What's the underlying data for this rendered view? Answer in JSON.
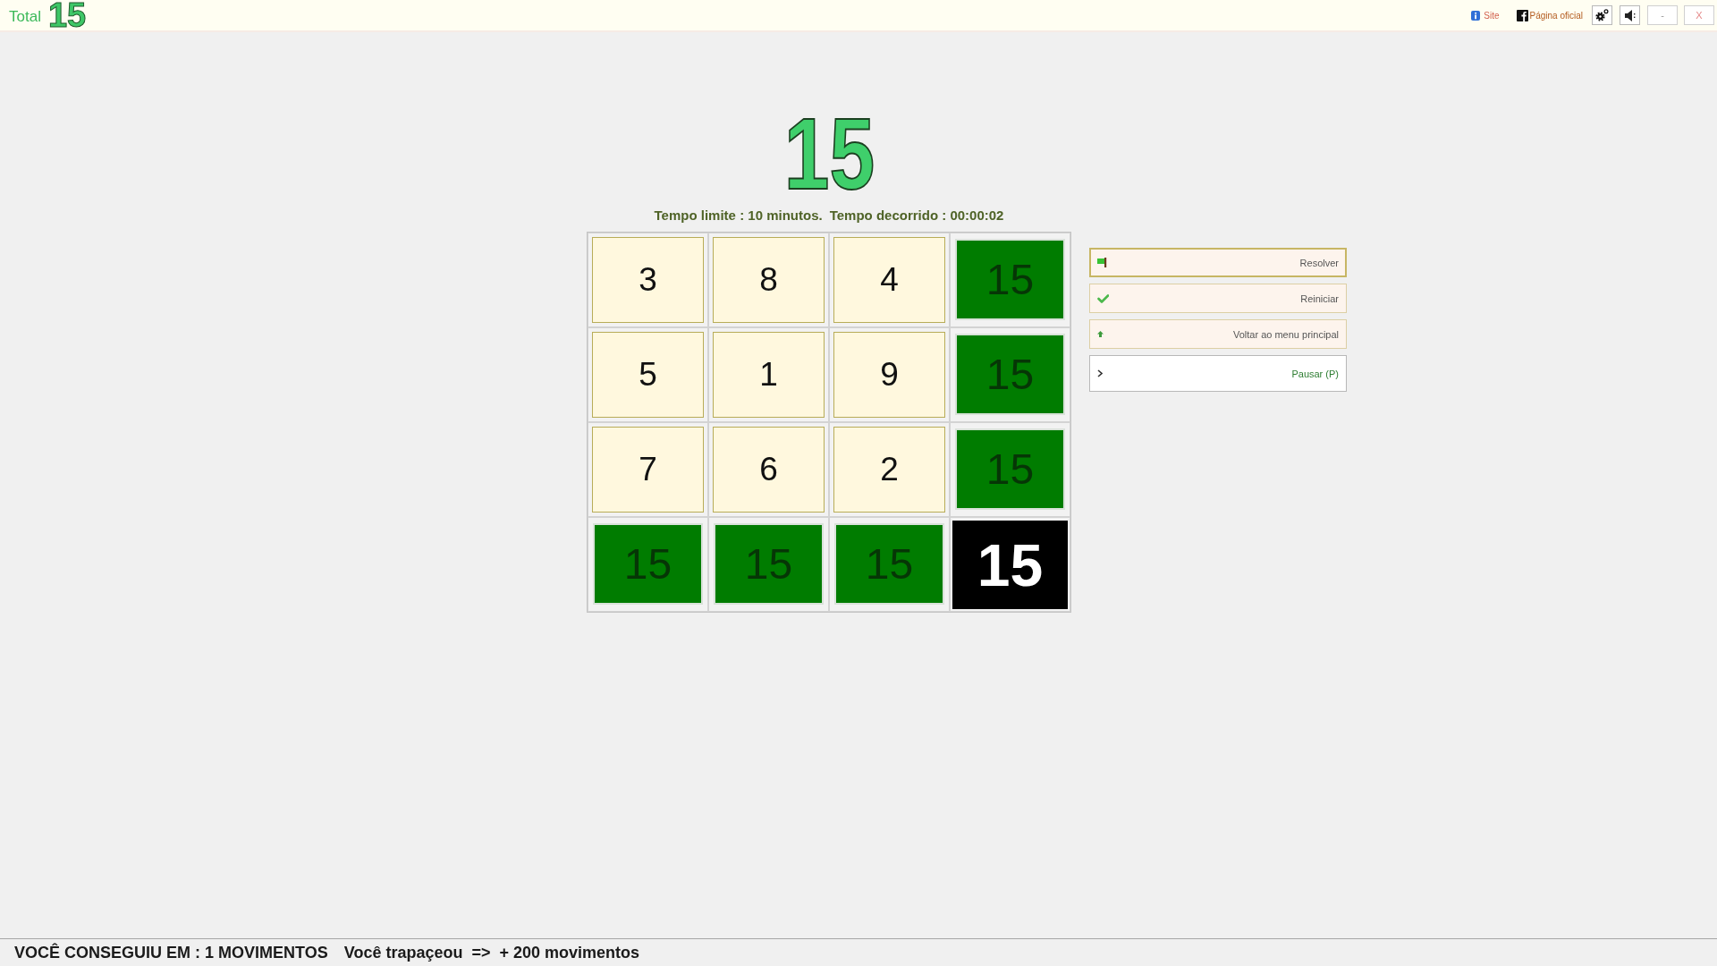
{
  "header": {
    "brand": "Total",
    "logo": "15",
    "links": [
      {
        "label": "Site",
        "kind": "site"
      },
      {
        "label": "Página oficial",
        "kind": "social"
      }
    ],
    "window_buttons": [
      {
        "label": "-",
        "kind": "minimize"
      },
      {
        "label": "X",
        "kind": "close"
      }
    ]
  },
  "game": {
    "title": "15",
    "time_limit": "Tempo limite : 10 minutos.",
    "elapsed": "Tempo decorrido : 00:00:02",
    "board": {
      "rows": [
        {
          "cells": [
            {
              "value": "3",
              "kind": "number"
            },
            {
              "value": "8",
              "kind": "number"
            },
            {
              "value": "4",
              "kind": "number"
            },
            {
              "value": "15",
              "kind": "sum"
            }
          ]
        },
        {
          "cells": [
            {
              "value": "5",
              "kind": "number"
            },
            {
              "value": "1",
              "kind": "number"
            },
            {
              "value": "9",
              "kind": "number"
            },
            {
              "value": "15",
              "kind": "sum"
            }
          ]
        },
        {
          "cells": [
            {
              "value": "7",
              "kind": "number"
            },
            {
              "value": "6",
              "kind": "number"
            },
            {
              "value": "2",
              "kind": "number"
            },
            {
              "value": "15",
              "kind": "sum"
            }
          ]
        },
        {
          "cells": [
            {
              "value": "15",
              "kind": "sum"
            },
            {
              "value": "15",
              "kind": "sum"
            },
            {
              "value": "15",
              "kind": "sum"
            },
            {
              "value": "15",
              "kind": "total"
            }
          ]
        }
      ]
    }
  },
  "actions": [
    {
      "label": "Resolver",
      "kind": "solve",
      "focused": true
    },
    {
      "label": "Reiniciar",
      "kind": "restart",
      "focused": false
    },
    {
      "label": "Voltar ao menu principal",
      "kind": "menu",
      "focused": false
    },
    {
      "label": "Pausar (P)",
      "kind": "pause",
      "focused": false
    }
  ],
  "status_bar": {
    "moves": "VOCÊ CONSEGUIU EM : 1 MOVIMENTOS",
    "penalty": "Você trapaçeou  =>  + 200 movimentos"
  }
}
